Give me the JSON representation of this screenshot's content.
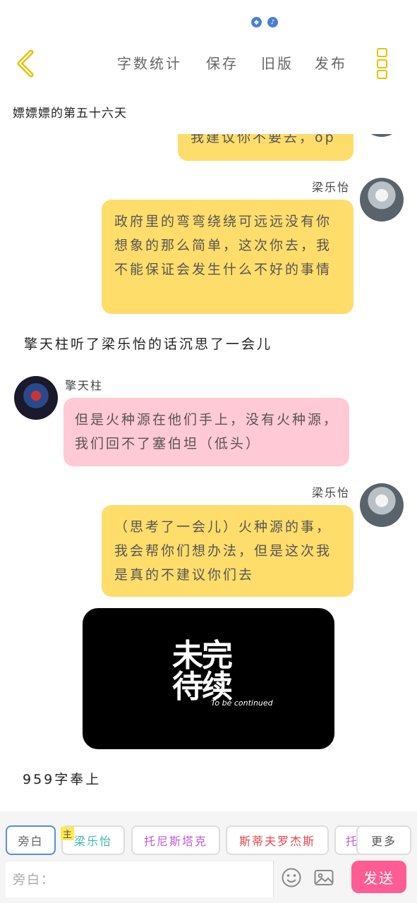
{
  "topbar": {
    "nav": [
      "字数统计",
      "保存",
      "旧版",
      "发布"
    ]
  },
  "chapter_title": "嫖嫖嫖的第五十六天",
  "messages": {
    "m0": {
      "text": "我建议你不要去，op"
    },
    "m1": {
      "speaker": "梁乐怡",
      "text": "政府里的弯弯绕绕可远远没有你想象的那么简单，这次你去，我不能保证会发生什么不好的事情"
    },
    "narration1": "擎天柱听了梁乐怡的话沉思了一会儿",
    "m2": {
      "speaker": "擎天柱",
      "text": "但是火种源在他们手上，没有火种源，我们回不了塞伯坦（低头）"
    },
    "m3": {
      "speaker": "梁乐怡",
      "text": "（思考了一会儿）火种源的事，我会帮你们想办法，但是这次我是真的不建议你们去"
    },
    "image": {
      "big": "未完待续",
      "small": "To be continued"
    },
    "narration2": "959字奉上"
  },
  "bottom": {
    "chips": {
      "aside": "旁白",
      "c1": "梁乐怡",
      "c2": "托尼斯塔克",
      "c3": "斯蒂夫罗杰斯",
      "c4": "托",
      "more": "更多"
    },
    "main_tag": "主",
    "placeholder": "旁白：",
    "send": "发送"
  },
  "colors": {
    "self_bubble": "#ffdd6b",
    "other_bubble": "#ffc9d5",
    "send": "#ff5c94",
    "accent": "#e6c200"
  },
  "icons": [
    "back-icon",
    "menu-icon",
    "emoji-icon",
    "image-icon"
  ]
}
